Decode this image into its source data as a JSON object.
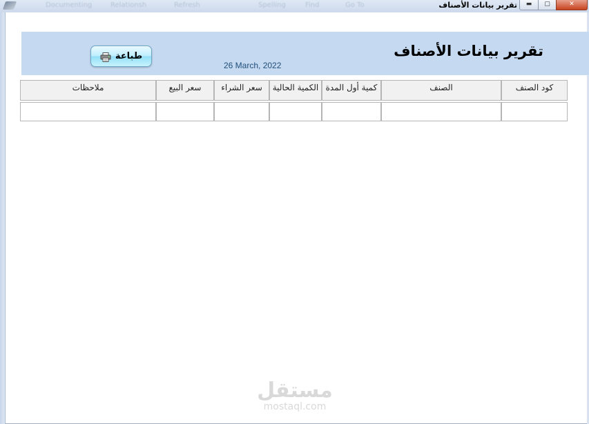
{
  "window": {
    "title": "تقرير بيانات الأصناف",
    "min_symbol": "▬",
    "max_symbol": "▢",
    "close_symbol": "✕"
  },
  "ribbon_ghost": [
    "Documenting",
    "Relationsh",
    "Refresh",
    "Spelling",
    "Find",
    "Go To"
  ],
  "report": {
    "title": "تقرير بيانات الأصناف",
    "date": "26 March, 2022",
    "print_button": "طباعة",
    "print_icon": "printer-icon"
  },
  "table": {
    "columns": [
      "كود الصنف",
      "الصنف",
      "كمية أول المدة",
      "الكمية الحالية",
      "سعر الشراء",
      "سعر البيع",
      "ملاحظات"
    ],
    "rows": [
      [
        "",
        "",
        "",
        "",
        "",
        "",
        ""
      ]
    ]
  },
  "watermark": {
    "arabic": "مستقل",
    "latin": "mostaql.com"
  },
  "colors": {
    "header_band": "#c5d9f1",
    "date_text": "#1f4e79",
    "button_accent": "#93dff7"
  }
}
